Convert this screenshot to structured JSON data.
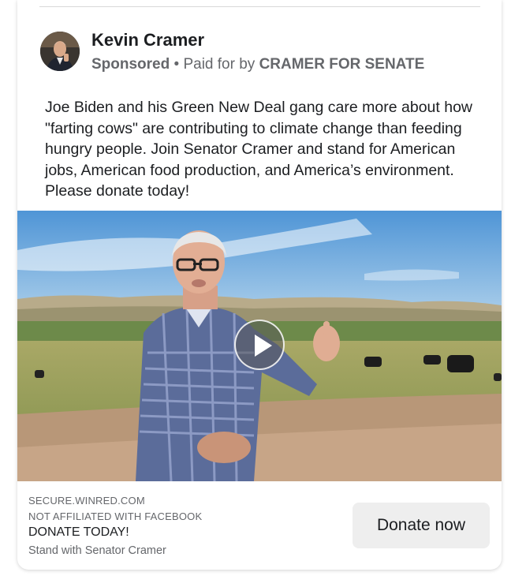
{
  "post": {
    "author": "Kevin Cramer",
    "sponsored_label": "Sponsored",
    "separator": " • ",
    "paid_for_prefix": "Paid for by ",
    "payer": "CRAMER FOR SENATE",
    "body": "Joe Biden and his Green New Deal gang care more about how \"farting cows\" are contributing to climate change than feeding hungry people. Join Senator Cramer and stand for American jobs, American food production, and America’s environment. Please donate today!"
  },
  "video": {
    "play_icon": "play-icon"
  },
  "footer": {
    "domain": "SECURE.WINRED.COM",
    "disclaimer": "NOT AFFILIATED WITH FACEBOOK",
    "headline": "DONATE TODAY!",
    "description": "Stand with Senator Cramer",
    "cta_label": "Donate now"
  },
  "colors": {
    "text_primary": "#1c1e21",
    "text_secondary": "#65676b",
    "cta_background": "#eeeeee"
  }
}
